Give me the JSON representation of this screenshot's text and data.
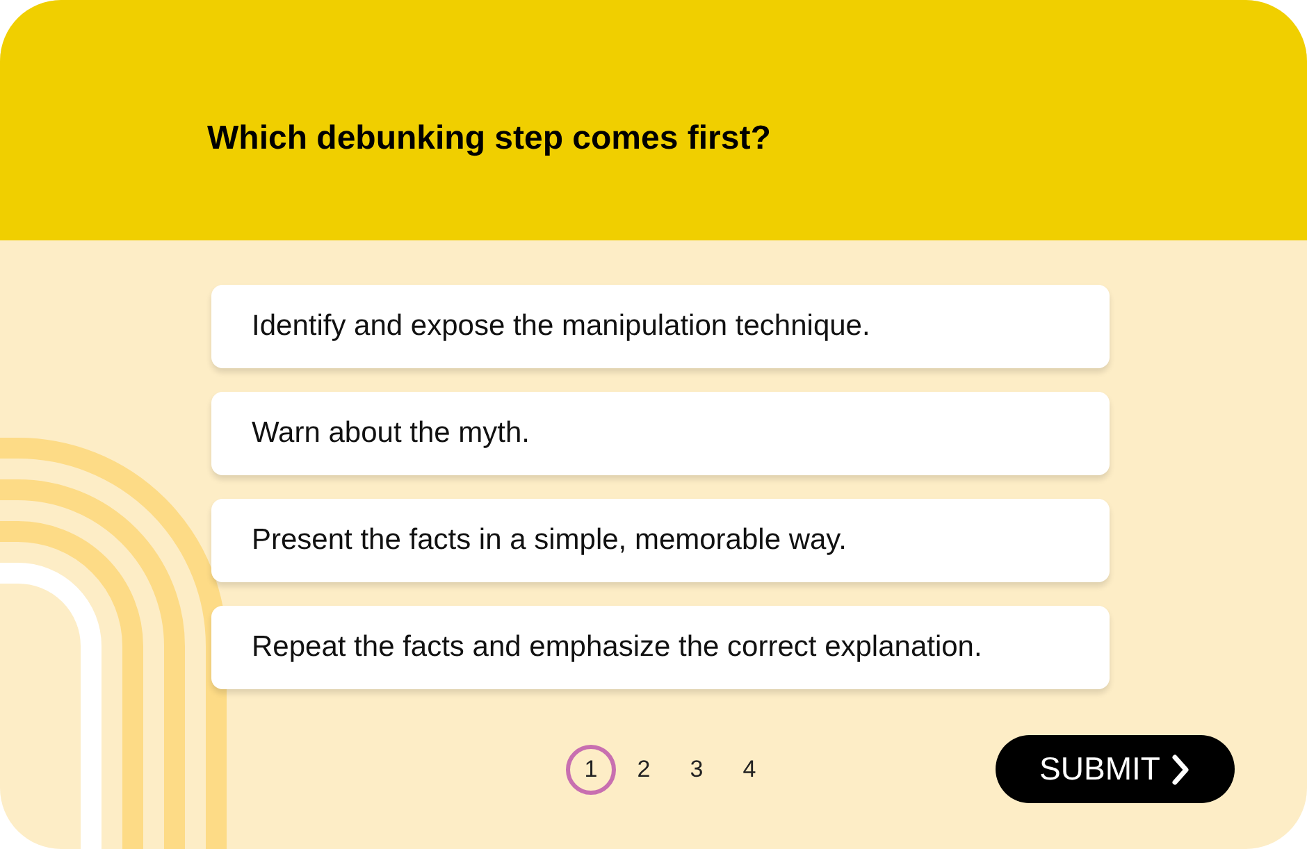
{
  "question": "Which debunking step comes first?",
  "options": [
    {
      "text": "Identify and expose the manipulation technique."
    },
    {
      "text": "Warn about the myth."
    },
    {
      "text": "Present the facts in a simple, memorable way."
    },
    {
      "text": "Repeat the facts and emphasize the correct explanation."
    }
  ],
  "pages": [
    {
      "label": "1",
      "selected": true
    },
    {
      "label": "2",
      "selected": false
    },
    {
      "label": "3",
      "selected": false
    },
    {
      "label": "4",
      "selected": false
    }
  ],
  "submit": "SUBMIT"
}
